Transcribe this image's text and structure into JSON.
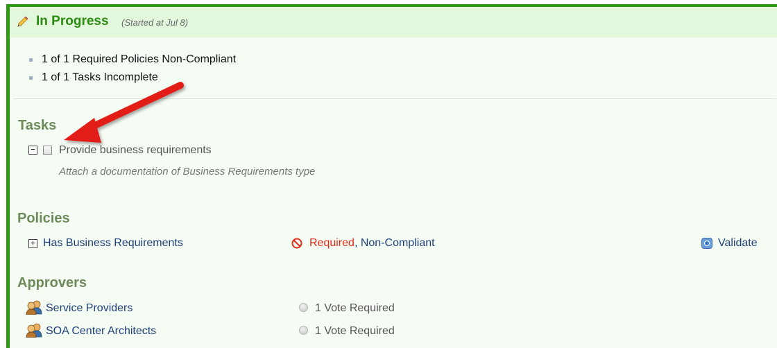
{
  "header": {
    "title": "In Progress",
    "started": "(Started at Jul 8)"
  },
  "summary": [
    "1 of 1 Required Policies Non-Compliant",
    "1 of 1 Tasks Incomplete"
  ],
  "tasks": {
    "title": "Tasks",
    "items": [
      {
        "toggle": "−",
        "label": "Provide business requirements",
        "description": "Attach a documentation of Business Requirements type",
        "checked": false
      }
    ]
  },
  "policies": {
    "title": "Policies",
    "items": [
      {
        "toggle": "+",
        "name": "Has Business Requirements",
        "status_required": "Required",
        "status_separator": ",",
        "status_compliance": "Non-Compliant",
        "action": "Validate"
      }
    ]
  },
  "approvers": {
    "title": "Approvers",
    "items": [
      {
        "name": "Service Providers",
        "vote": "1 Vote Required"
      },
      {
        "name": "SOA Center Architects",
        "vote": "1 Vote Required"
      }
    ]
  },
  "colors": {
    "frame_border": "#2e9a14",
    "header_bg": "#e3f7dc",
    "title_green": "#2a8a12",
    "section_title": "#6e8a5a",
    "link": "#1f3f7a",
    "error_red": "#e52a1a",
    "annotation_arrow": "#e21b14"
  },
  "icons": {
    "header": "pencil-icon",
    "policy_status": "no-entry-icon",
    "validate": "validate-icon",
    "approver": "people-icon"
  }
}
